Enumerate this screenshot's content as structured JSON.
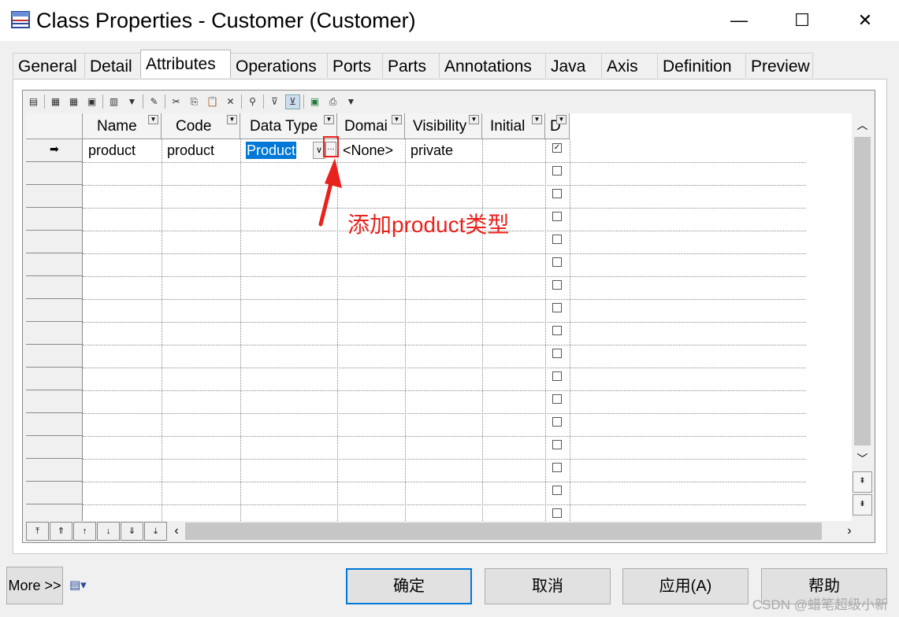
{
  "window": {
    "title": "Class Properties - Customer (Customer)",
    "minimize": "—",
    "maximize": "☐",
    "close": "✕"
  },
  "tabs": [
    "General",
    "Detail",
    "Attributes",
    "Operations",
    "Ports",
    "Parts",
    "Annotations",
    "Java",
    "Axis",
    "Definition",
    "Preview"
  ],
  "active_tab": "Attributes",
  "grid": {
    "columns": [
      "Name",
      "Code",
      "Data Type",
      "Domai",
      "Visibility",
      "Initial",
      "D"
    ],
    "rows": [
      {
        "marker": "➡",
        "name": "product",
        "code": "product",
        "data_type": "Product",
        "domain": "<None>",
        "visibility": "private",
        "initial": "",
        "checked": true
      }
    ],
    "empty_row_checkbox_count": 16
  },
  "annotation": {
    "text": "添加product类型",
    "color": "#e8221c"
  },
  "footer": {
    "more_label": "More >>",
    "ok_label": "确定",
    "cancel_label": "取消",
    "apply_label": "应用(A)",
    "help_label": "帮助"
  },
  "watermark": "CSDN @蜡笔超级小新",
  "colors": {
    "selection": "#0078d7",
    "default_button_border": "#0078d7"
  }
}
